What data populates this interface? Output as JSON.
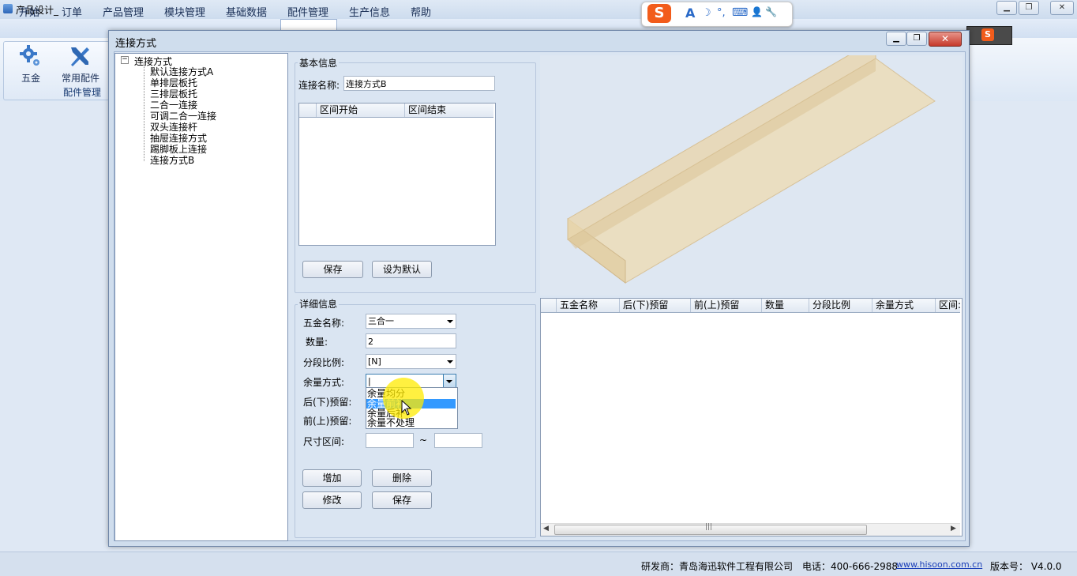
{
  "app": {
    "title": "产品设计_",
    "menu": [
      "开始",
      "订单",
      "产品管理",
      "模块管理",
      "基础数据",
      "配件管理",
      "生产信息",
      "帮助"
    ],
    "ribbon": {
      "buttons": [
        {
          "label": "五金",
          "icon": "gear-icon"
        },
        {
          "label": "常用配件",
          "icon": "wrench-icon"
        }
      ],
      "group_label": "配件管理"
    },
    "status": {
      "developer": "研发商：青岛海迅软件工程有限公司",
      "phone": "电话：400-666-2988",
      "website": "www.hisoon.com.cn",
      "version": "版本号： V4.0.0"
    }
  },
  "ime": {
    "logo": "S",
    "glyphs": [
      "A",
      "☽",
      "°,",
      "⌨",
      "👤",
      "🔧"
    ]
  },
  "dialog": {
    "title": "连接方式",
    "tree": {
      "root": "连接方式",
      "toggle": "−",
      "children": [
        "默认连接方式A",
        "单排层板托",
        "三排层板托",
        "二合一连接",
        "可调二合一连接",
        "双头连接杆",
        "抽屉连接方式",
        "踢脚板上连接",
        "连接方式B"
      ]
    },
    "basic": {
      "legend": "基本信息",
      "name_label": "连接名称:",
      "name_value": "连接方式B",
      "grid_headers": [
        "区间开始",
        "区间结束"
      ],
      "save_button": "保存",
      "default_button": "设为默认"
    },
    "detail": {
      "legend": "详细信息",
      "hardware_label": "五金名称:",
      "hardware_value": "三合一",
      "qty_label": "数量:",
      "qty_value": "2",
      "ratio_label": "分段比例:",
      "ratio_value": "[N]",
      "remainder_label": "余量方式:",
      "remainder_value": "|",
      "rear_label": "后(下)预留:",
      "front_label": "前(上)预留:",
      "range_label": "尺寸区间:",
      "range_sep": "~",
      "dropdown_options": [
        "余量均分",
        "余量前补",
        "余量后补",
        "余量不处理"
      ],
      "dropdown_selected": "余量前补",
      "add_button": "增加",
      "delete_button": "删除",
      "modify_button": "修改",
      "save_button": "保存"
    },
    "detail_grid": {
      "headers": [
        "五金名称",
        "后(下)预留",
        "前(上)预留",
        "数量",
        "分段比例",
        "余量方式",
        "区间:"
      ],
      "scroll_thumb": "|||"
    }
  },
  "colors": {
    "preview_board": "#ecdcb8",
    "highlight": "#3399ff",
    "close_button": "#c6392b"
  }
}
